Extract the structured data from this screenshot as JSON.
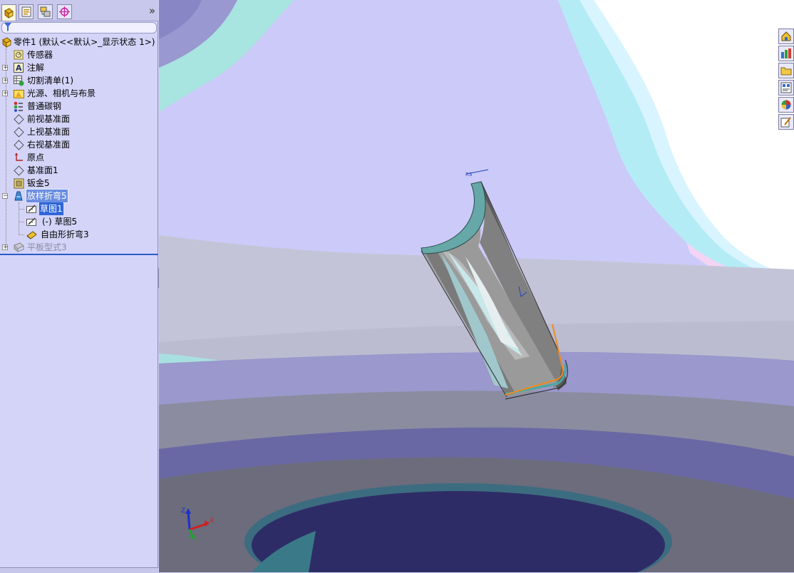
{
  "feature_manager": {
    "tabs": [
      {
        "name": "featuremanager-tab",
        "icon": "feature-tree-icon"
      },
      {
        "name": "propertymanager-tab",
        "icon": "property-sheet-icon"
      },
      {
        "name": "configurationmanager-tab",
        "icon": "configuration-icon"
      },
      {
        "name": "dimxpert-tab",
        "icon": "crosshair-target-icon"
      }
    ],
    "expand_label": "»",
    "filter_icon": "filter-funnel-icon",
    "tree": [
      {
        "label": "零件1  (默认<<默认>_显示状态 1>)",
        "icon": "part-icon",
        "level": 0
      },
      {
        "label": "传感器",
        "icon": "sensor-icon",
        "level": 1
      },
      {
        "label": "注解",
        "icon": "annotation-icon",
        "level": 1,
        "expander": "+"
      },
      {
        "label": "切割清单(1)",
        "icon": "cut-list-icon",
        "level": 1,
        "expander": "+"
      },
      {
        "label": "光源、相机与布景",
        "icon": "lights-cameras-icon",
        "level": 1,
        "expander": "+"
      },
      {
        "label": "普通碳钢",
        "icon": "material-icon",
        "level": 1
      },
      {
        "label": "前视基准面",
        "icon": "plane-icon",
        "level": 1
      },
      {
        "label": "上视基准面",
        "icon": "plane-icon",
        "level": 1
      },
      {
        "label": "右视基准面",
        "icon": "plane-icon",
        "level": 1
      },
      {
        "label": "原点",
        "icon": "origin-icon",
        "level": 1
      },
      {
        "label": "基准面1",
        "icon": "plane-icon",
        "level": 1
      },
      {
        "label": "钣金5",
        "icon": "sheet-metal-icon",
        "level": 1
      },
      {
        "label": "放样折弯5",
        "icon": "lofted-bend-icon",
        "level": 1,
        "expander": "−",
        "state": "selected-dashed"
      },
      {
        "label": "草图1",
        "icon": "sketch-icon",
        "level": 2,
        "state": "selected"
      },
      {
        "label": "(-) 草图5",
        "icon": "sketch-icon",
        "level": 2
      },
      {
        "label": "自由形折弯3",
        "icon": "free-form-bend-icon",
        "level": 2
      },
      {
        "label": "平板型式3",
        "icon": "flat-pattern-icon",
        "level": 1,
        "expander": "+",
        "state": "suppressed"
      }
    ]
  },
  "task_pane_buttons": [
    {
      "name": "solidworks-resources-icon",
      "glyph": "⌂"
    },
    {
      "name": "design-library-icon",
      "glyph": "▦"
    },
    {
      "name": "file-explorer-icon",
      "glyph": "🗀"
    },
    {
      "name": "view-palette-icon",
      "glyph": "▤"
    },
    {
      "name": "appearances-icon",
      "glyph": "●"
    },
    {
      "name": "custom-properties-icon",
      "glyph": "✎"
    }
  ],
  "triad": {
    "x": "X",
    "y": "Y",
    "z": "Z"
  },
  "colors": {
    "panel_bg": "#d4d4f8",
    "selection": "#2f66d8",
    "sketch_orange": "#f08a1c",
    "part_gray": "#7a7a7a"
  }
}
